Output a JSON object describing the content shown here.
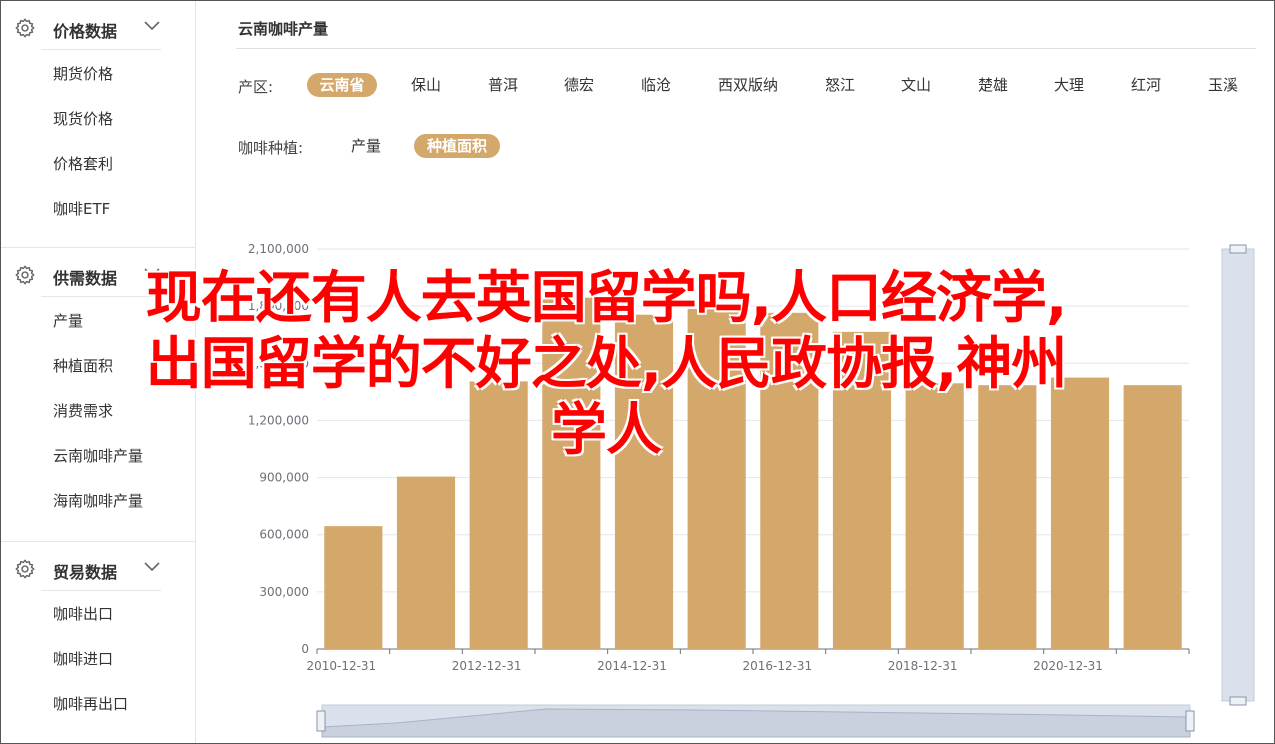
{
  "sidebar": {
    "sections": [
      {
        "title": "价格数据",
        "items": [
          "期货价格",
          "现货价格",
          "价格套利",
          "咖啡ETF"
        ]
      },
      {
        "title": "供需数据",
        "items": [
          "产量",
          "种植面积",
          "消费需求",
          "云南咖啡产量",
          "海南咖啡产量"
        ]
      },
      {
        "title": "贸易数据",
        "items": [
          "咖啡出口",
          "咖啡进口",
          "咖啡再出口"
        ]
      }
    ]
  },
  "header": {
    "title": "云南咖啡产量"
  },
  "filters": {
    "region_label": "产区:",
    "regions": [
      "云南省",
      "保山",
      "普洱",
      "德宏",
      "临沧",
      "西双版纳",
      "怒江",
      "文山",
      "楚雄",
      "大理",
      "红河",
      "玉溪"
    ],
    "region_selected": "云南省",
    "type_label": "咖啡种植:",
    "types": [
      "产量",
      "种植面积"
    ],
    "type_selected": "种植面积"
  },
  "colors": {
    "accent": "#d4a86a",
    "bar": "#d4a86a",
    "headline": "#ff0000"
  },
  "chart_data": {
    "type": "bar",
    "x": [
      "2010-12-31",
      "2011-12-31",
      "2012-12-31",
      "2013-12-31",
      "2014-12-31",
      "2015-12-31",
      "2016-12-31",
      "2017-12-31",
      "2018-12-31",
      "2019-12-31",
      "2020-12-31",
      "2021-12-31"
    ],
    "x_tick_labels": [
      "2010-12-31",
      "2012-12-31",
      "2014-12-31",
      "2016-12-31",
      "2018-12-31",
      "2020-12-31"
    ],
    "values": [
      645000,
      905000,
      1405000,
      1845000,
      1755000,
      1785000,
      1765000,
      1665000,
      1395000,
      1385000,
      1425000,
      1385000
    ],
    "y_ticks": [
      0,
      300000,
      600000,
      900000,
      1200000,
      1500000,
      1800000,
      2100000
    ],
    "y_tick_labels": [
      "0",
      "300,000",
      "600,000",
      "900,000",
      "1,200,000",
      "1,500,000",
      "1,800,000",
      "2,100,000"
    ],
    "ylim": [
      0,
      2100000
    ],
    "grid": true,
    "legend": "none"
  },
  "overlay": {
    "headline_lines": [
      "现在还有人去英国留学吗,人口经济学,",
      "出国留学的不好之处,人民政协报,神州",
      "学人"
    ]
  }
}
